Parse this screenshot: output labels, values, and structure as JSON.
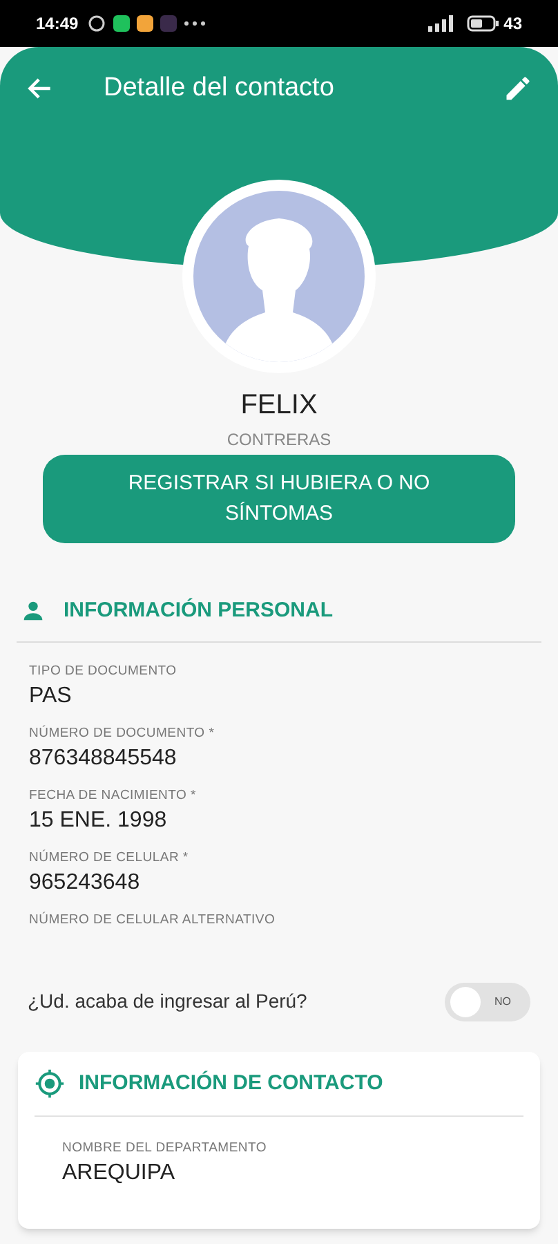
{
  "status_bar": {
    "time": "14:49",
    "battery": "43"
  },
  "header": {
    "title": "Detalle del contacto"
  },
  "profile": {
    "first_name": "FELIX",
    "last_name": "CONTRERAS"
  },
  "symptoms_button": {
    "label": "REGISTRAR SI HUBIERA O NO SÍNTOMAS"
  },
  "personal_section": {
    "title": "INFORMACIÓN PERSONAL",
    "fields": [
      {
        "label": "TIPO DE DOCUMENTO",
        "value": "PAS"
      },
      {
        "label": "NÚMERO DE DOCUMENTO *",
        "value": "876348845548"
      },
      {
        "label": "FECHA DE NACIMIENTO *",
        "value": "15 ENE. 1998"
      },
      {
        "label": "NÚMERO DE CELULAR *",
        "value": "965243648"
      },
      {
        "label": "NÚMERO DE CELULAR ALTERNATIVO"
      }
    ]
  },
  "arrival_toggle": {
    "label": "¿Ud. acaba de ingresar al Perú?",
    "on": false,
    "state_label": "NO"
  },
  "contact_section": {
    "title": "INFORMACIÓN DE CONTACTO",
    "fields": [
      {
        "label": "NOMBRE DEL DEPARTAMENTO",
        "value": "AREQUIPA"
      }
    ]
  }
}
